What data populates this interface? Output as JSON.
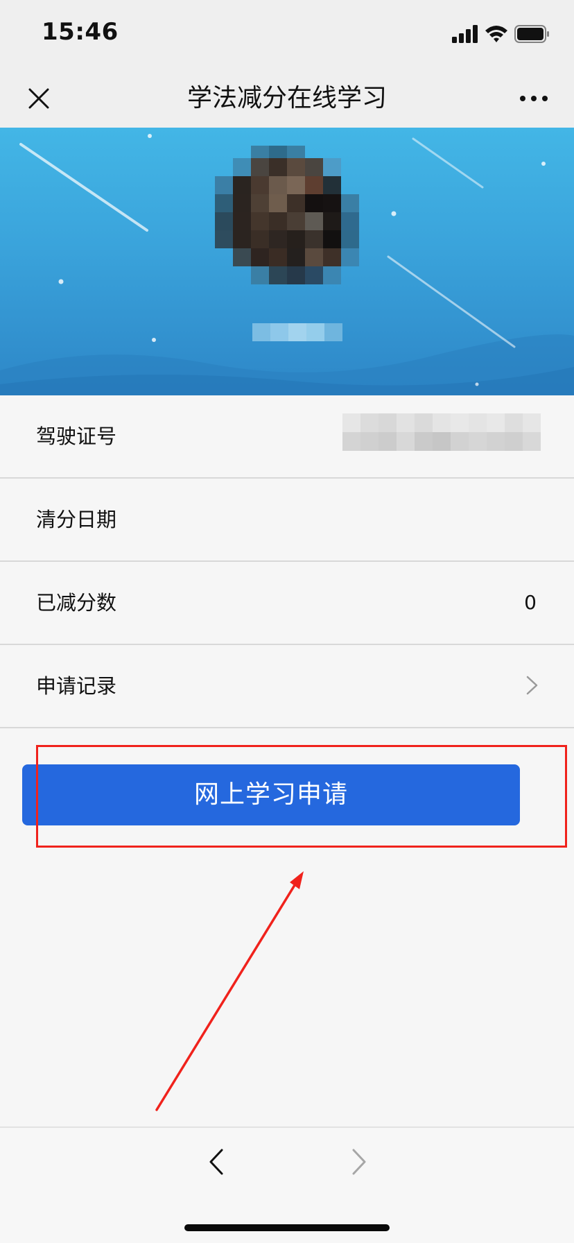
{
  "status_bar": {
    "time": "15:46",
    "icons": [
      "signal-icon",
      "wifi-icon",
      "battery-icon"
    ]
  },
  "nav_bar": {
    "title": "学法减分在线学习",
    "left_icon": "close-icon",
    "right_icon": "more-icon"
  },
  "banner": {
    "background_color": "#3aa3db",
    "avatar": "pixelated-avatar"
  },
  "rows": {
    "license": {
      "label": "驾驶证号"
    },
    "clear_date": {
      "label": "清分日期",
      "value": ""
    },
    "deducted": {
      "label": "已减分数",
      "value": "0"
    },
    "records": {
      "label": "申请记录",
      "icon": "chevron-right-icon"
    }
  },
  "apply_button": {
    "label": "网上学习申请",
    "color": "#2568de"
  },
  "annotation": {
    "color": "#f0221c"
  },
  "bottom_bar": {
    "icons": [
      "back-arrow-icon",
      "forward-arrow-icon"
    ]
  }
}
